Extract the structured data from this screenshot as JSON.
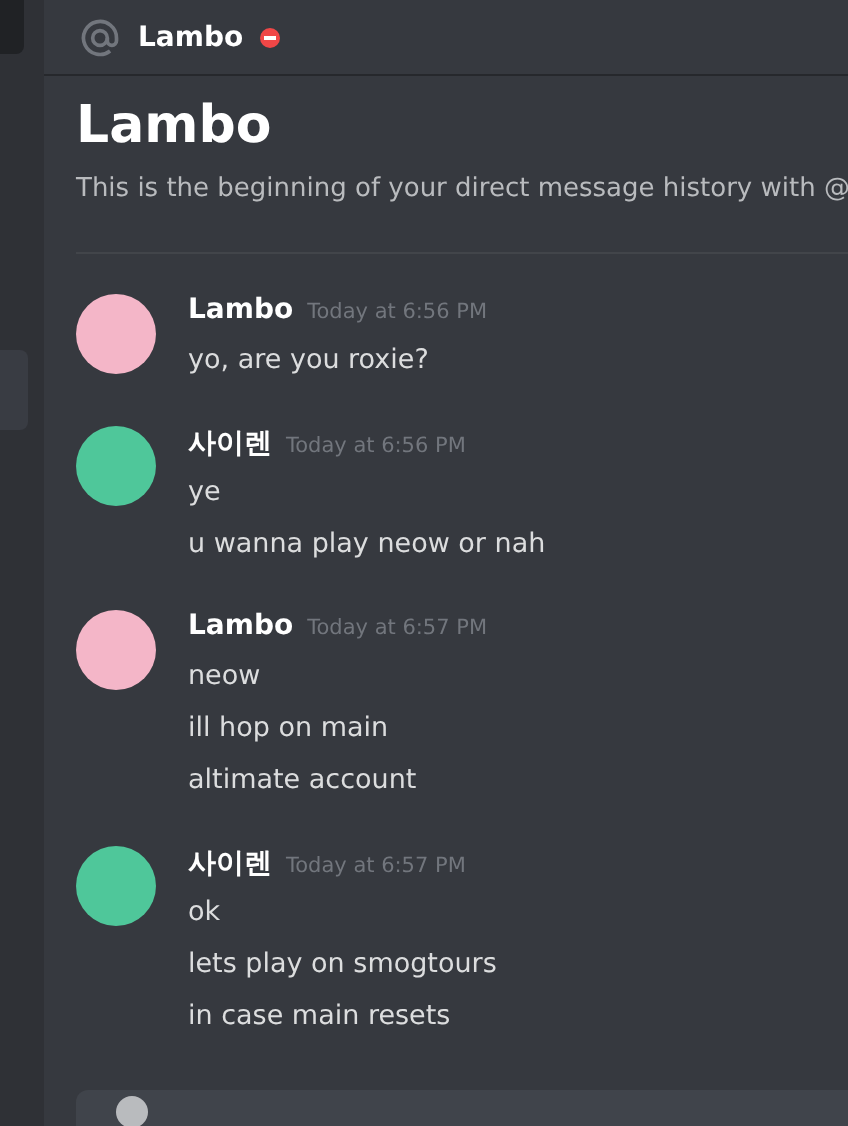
{
  "header": {
    "title": "Lambo",
    "do_not_disturb": true
  },
  "intro": {
    "title": "Lambo",
    "text": "This is the beginning of your direct message history with @"
  },
  "messages": [
    {
      "author": "Lambo",
      "time": "Today at 6:56 PM",
      "color": "#f4b6c8",
      "lines": [
        "yo, are you roxie?"
      ]
    },
    {
      "author": "사이렌",
      "time": "Today at 6:56 PM",
      "color": "#4fc79a",
      "lines": [
        "ye",
        "u wanna play neow or nah"
      ]
    },
    {
      "author": "Lambo",
      "time": "Today at 6:57 PM",
      "color": "#f4b6c8",
      "lines": [
        "neow",
        "ill hop on main",
        "altimate account"
      ]
    },
    {
      "author": "사이렌",
      "time": "Today at 6:57 PM",
      "color": "#4fc79a",
      "lines": [
        "ok",
        "lets play on smogtours",
        "in case main resets"
      ]
    }
  ]
}
